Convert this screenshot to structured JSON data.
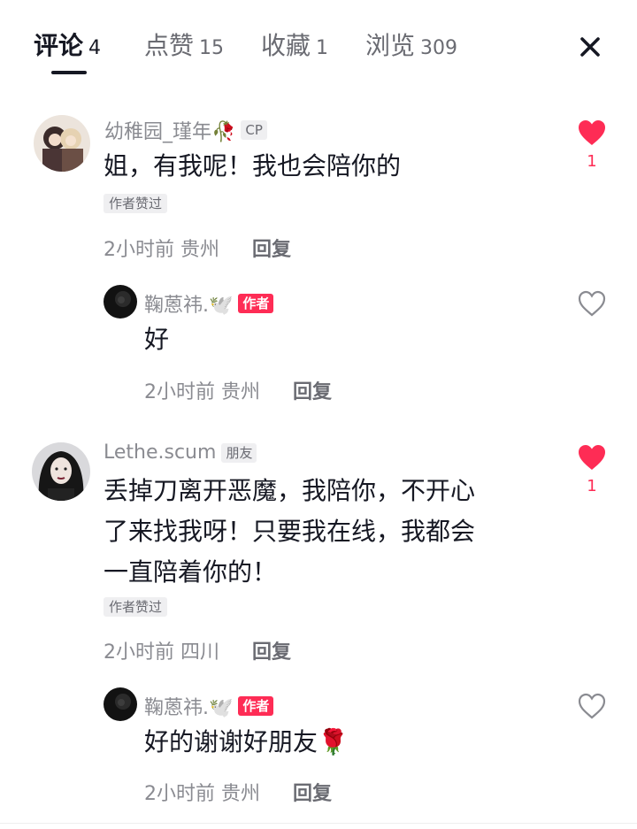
{
  "tabs": [
    {
      "label": "评论",
      "count": "4"
    },
    {
      "label": "点赞",
      "count": "15"
    },
    {
      "label": "收藏",
      "count": "1"
    },
    {
      "label": "浏览",
      "count": "309"
    }
  ],
  "comments": [
    {
      "username": "幼稚园_瑾年🥀",
      "tag": "CP",
      "text": "姐，有我呢！我也会陪你的",
      "liked_by_author": "作者赞过",
      "time": "2小时前",
      "location": "贵州",
      "reply_label": "回复",
      "likes": "1",
      "reply": {
        "username": "鞠蒽祎.🕊️",
        "tag": "作者",
        "text": "好",
        "time": "2小时前",
        "location": "贵州",
        "reply_label": "回复"
      }
    },
    {
      "username": "Lethe.scum",
      "tag": "朋友",
      "text_lines": [
        "丢掉刀离开恶魔，我陪你，不开心",
        "了来找我呀！只要我在线，我都会",
        "一直陪着你的！"
      ],
      "liked_by_author": "作者赞过",
      "time": "2小时前",
      "location": "四川",
      "reply_label": "回复",
      "likes": "1",
      "reply": {
        "username": "鞠蒽祎.🕊️",
        "tag": "作者",
        "text": "好的谢谢好朋友🌹",
        "time": "2小时前",
        "location": "贵州",
        "reply_label": "回复"
      }
    }
  ],
  "colors": {
    "accent": "#fe2c55",
    "text": "#161823",
    "muted": "#8a8b91"
  }
}
